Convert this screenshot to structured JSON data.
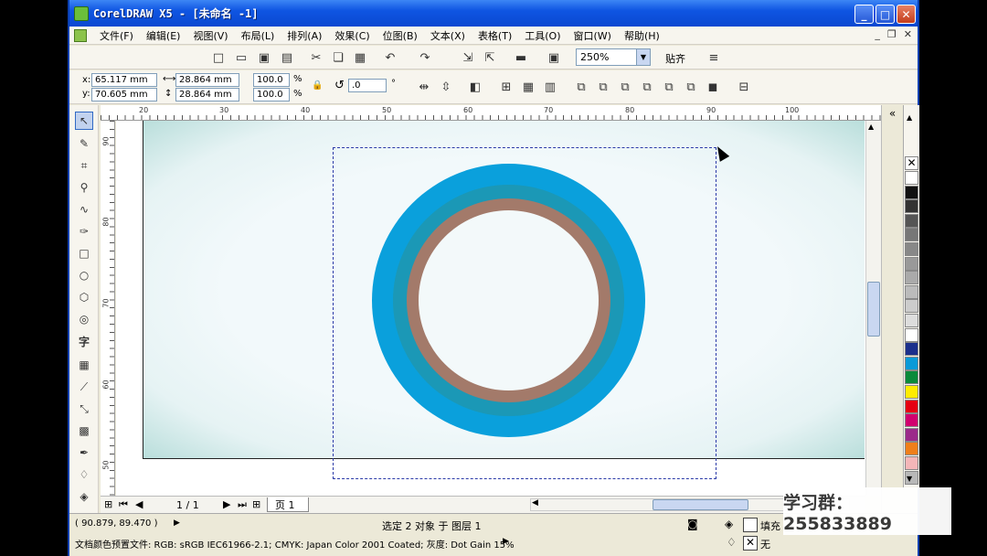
{
  "window": {
    "title": "CorelDRAW X5 - [未命名 -1]",
    "buttons": [
      "_",
      "□",
      "✕"
    ]
  },
  "menu": [
    "文件(F)",
    "编辑(E)",
    "视图(V)",
    "布局(L)",
    "排列(A)",
    "效果(C)",
    "位图(B)",
    "文本(X)",
    "表格(T)",
    "工具(O)",
    "窗口(W)",
    "帮助(H)"
  ],
  "toolbar": {
    "zoom": "250%",
    "snap_label": "贴齐"
  },
  "propbar": {
    "x_label": "x:",
    "x_value": "65.117 mm",
    "y_label": "y:",
    "y_value": "70.605 mm",
    "w_value": "28.864 mm",
    "h_value": "28.864 mm",
    "scale_w": "100.0",
    "scale_h": "100.0",
    "percent": "%",
    "rotation": ".0",
    "degree": "°"
  },
  "rulers": {
    "h_ticks": [
      "20",
      "30",
      "40",
      "50",
      "60",
      "70",
      "80",
      "90",
      "100"
    ],
    "v_ticks": [
      "90",
      "80",
      "70",
      "60",
      "50"
    ]
  },
  "pagebar": {
    "page_count": "1 / 1",
    "page_tab": "页 1"
  },
  "status": {
    "coords": "( 90.879, 89.470 )",
    "selection": "选定 2 对象 于 图层 1",
    "color_profile": "文档颜色预置文件: RGB: sRGB IEC61966-2.1; CMYK: Japan Color 2001 Coated; 灰度: Dot Gain 15%",
    "fill_label": "填充",
    "outline_label": "无"
  },
  "watermark": "学习群：255833889",
  "palette_colors": [
    "#ffffff",
    "#111111",
    "#333333",
    "#555555",
    "#777777",
    "#888888",
    "#999999",
    "#aaaaaa",
    "#bbbbbb",
    "#cccccc",
    "#dddddd",
    "#ffffff",
    "#1b2f8c",
    "#0a9ad8",
    "#0a8a3a",
    "#ffec00",
    "#e60012",
    "#d1006f",
    "#9b2a8a",
    "#ef7f1a",
    "#f4b6b8",
    "#b8b8b8"
  ],
  "colors": {
    "ring_outer": "#0aa0dc",
    "ring_teal": "#1b98b6",
    "ring_brown": "#a37a6a"
  }
}
